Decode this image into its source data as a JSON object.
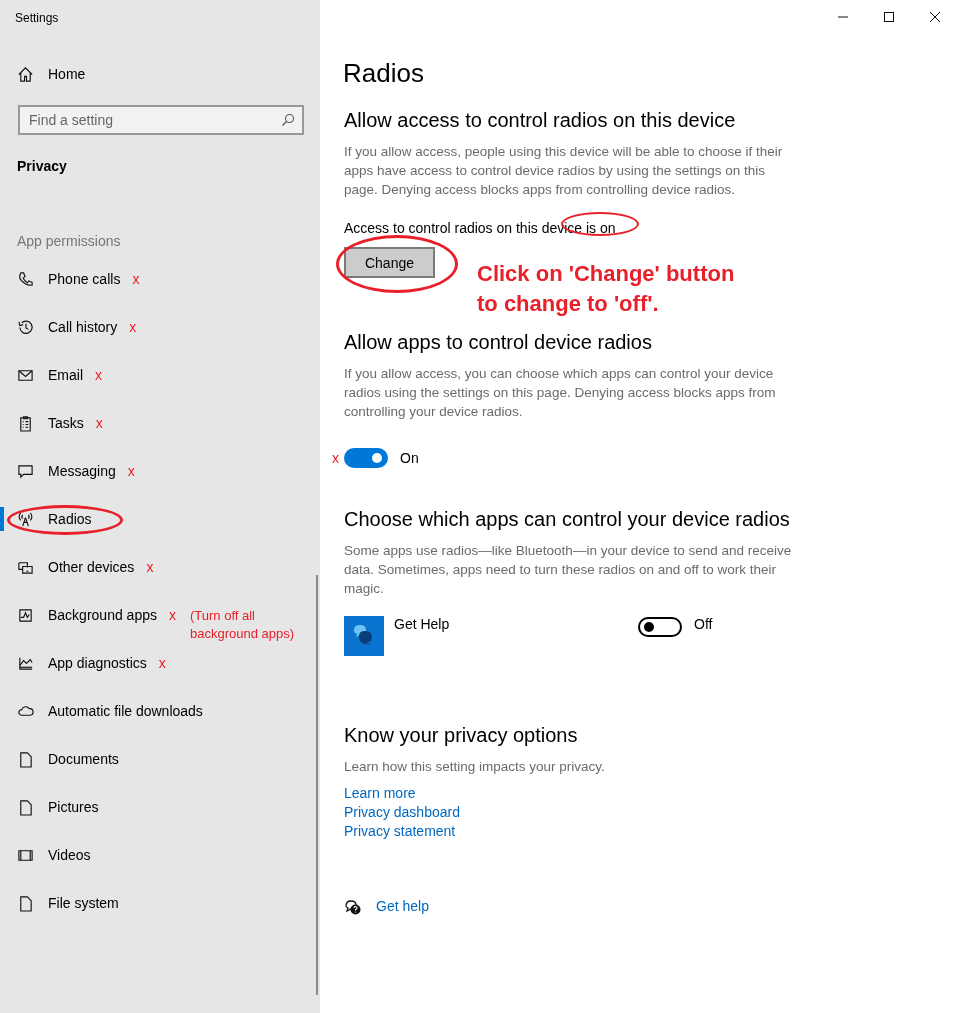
{
  "window": {
    "title": "Settings"
  },
  "sidebar": {
    "home": "Home",
    "search": {
      "placeholder": "Find a setting"
    },
    "section": "Privacy",
    "group": "App permissions",
    "items": [
      {
        "label": "Phone calls",
        "selected": false,
        "circled": false,
        "annotation": "x"
      },
      {
        "label": "Call history",
        "selected": false,
        "circled": false,
        "annotation": "x"
      },
      {
        "label": "Email",
        "selected": false,
        "circled": false,
        "annotation": "x"
      },
      {
        "label": "Tasks",
        "selected": false,
        "circled": false,
        "annotation": "x"
      },
      {
        "label": "Messaging",
        "selected": false,
        "circled": false,
        "annotation": "x"
      },
      {
        "label": "Radios",
        "selected": true,
        "circled": true
      },
      {
        "label": "Other devices",
        "selected": false,
        "circled": false,
        "annotation": "x"
      },
      {
        "label": "Background apps",
        "selected": false,
        "circled": false,
        "annotation": "x",
        "note": "(Turn off all background apps)"
      },
      {
        "label": "App diagnostics",
        "selected": false,
        "circled": false,
        "annotation": "x"
      },
      {
        "label": "Automatic file downloads",
        "selected": false,
        "circled": false
      },
      {
        "label": "Documents",
        "selected": false,
        "circled": false
      },
      {
        "label": "Pictures",
        "selected": false,
        "circled": false
      },
      {
        "label": "Videos",
        "selected": false,
        "circled": false
      },
      {
        "label": "File system",
        "selected": false,
        "circled": false
      }
    ]
  },
  "main": {
    "title": "Radios",
    "access": {
      "heading": "Allow access to control radios on this device",
      "description": "If you allow access, people using this device will be able to choose if their apps have access to control device radios by using the settings on this page. Denying access blocks apps from controlling device radios.",
      "status": "Access to control radios on this device is on",
      "status_circled": true,
      "button": "Change",
      "button_circled": true,
      "callout": "Click on 'Change' button to change to 'off'."
    },
    "apps_access": {
      "heading": "Allow apps to control device radios",
      "description": "If you allow access, you can choose which apps can control your device radios using the settings on this page. Denying access blocks apps from controlling your device radios.",
      "toggle": {
        "on": true,
        "label": "On"
      },
      "annotation": "x"
    },
    "choose": {
      "heading": "Choose which apps can control your device radios",
      "description": "Some apps use radios—like Bluetooth—in your device to send and receive data. Sometimes, apps need to turn these radios on and off to work their magic.",
      "apps": [
        {
          "name": "Get Help",
          "on": false,
          "label": "Off"
        }
      ]
    },
    "privacy": {
      "heading": "Know your privacy options",
      "description": "Learn how this setting impacts your privacy.",
      "links": [
        "Learn more",
        "Privacy dashboard",
        "Privacy statement"
      ]
    },
    "help": "Get help"
  }
}
